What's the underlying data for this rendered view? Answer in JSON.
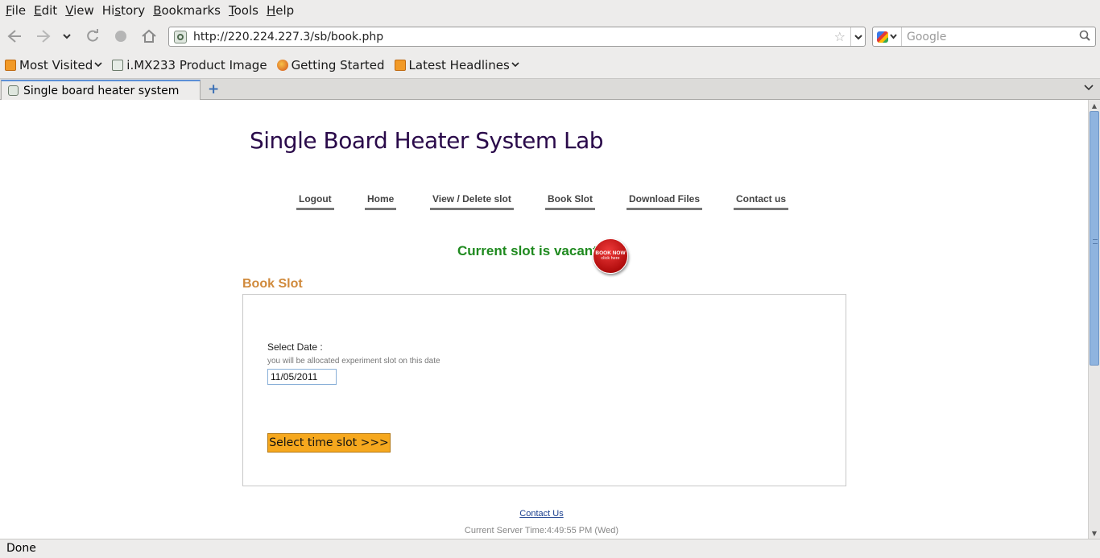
{
  "menubar": {
    "items": [
      {
        "accel": "F",
        "rest": "ile"
      },
      {
        "accel": "E",
        "rest": "dit"
      },
      {
        "accel": "V",
        "rest": "iew"
      },
      {
        "accel": "H",
        "pre": "Hi",
        "rest": "story"
      },
      {
        "accel": "B",
        "rest": "ookmarks"
      },
      {
        "accel": "T",
        "rest": "ools"
      },
      {
        "accel": "H",
        "rest": "elp"
      }
    ]
  },
  "navigation": {
    "url": "http://220.224.227.3/sb/book.php",
    "search_placeholder": "Google"
  },
  "bookmarks": {
    "items": [
      {
        "label": "Most Visited",
        "icon": "rss-icon",
        "has_menu": true
      },
      {
        "label": "i.MX233 Product Image",
        "icon": "page-icon",
        "has_menu": false
      },
      {
        "label": "Getting Started",
        "icon": "firefox-icon",
        "has_menu": false
      },
      {
        "label": "Latest Headlines",
        "icon": "rss-icon",
        "has_menu": true
      }
    ]
  },
  "tabs": {
    "active_title": "Single board heater system",
    "new_tab_glyph": "+",
    "list_glyph": "⌄"
  },
  "page": {
    "site_title": "Single Board Heater System Lab",
    "nav": [
      {
        "label": "Logout"
      },
      {
        "label": "Home"
      },
      {
        "label": "View / Delete slot"
      },
      {
        "label": "Book Slot"
      },
      {
        "label": "Download Files"
      },
      {
        "label": "Contact us"
      }
    ],
    "vacancy_message": "Current slot is vacant",
    "book_now": {
      "line1": "BOOK NOW",
      "line2": "click here"
    },
    "section_title": "Book Slot",
    "form": {
      "date_label": "Select Date :",
      "date_hint": "you will be allocated experiment slot on this date",
      "date_value": "11/05/2011",
      "submit_label": "Select time slot >>>"
    },
    "footer_link": "Contact Us",
    "server_time": "Current Server Time:4:49:55 PM (Wed)"
  },
  "status": {
    "text": "Done"
  },
  "colors": {
    "site_title": "#2a0a4a",
    "vacant_text": "#1f8a1f",
    "section_title": "#d08a3c",
    "submit_button": "#f6a81e",
    "book_now": "#c41414"
  }
}
